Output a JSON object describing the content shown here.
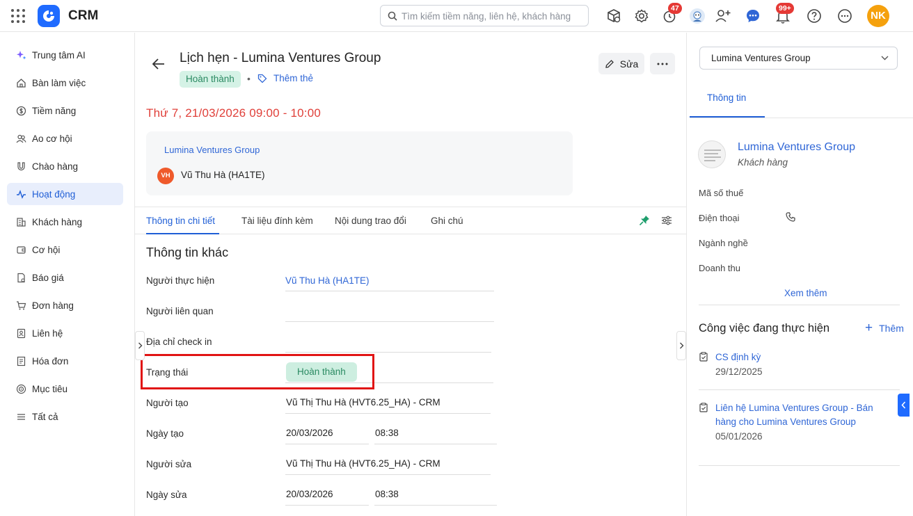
{
  "app": {
    "name": "CRM"
  },
  "search": {
    "placeholder": "Tìm kiếm tiềm năng, liên hệ, khách hàng"
  },
  "topbar": {
    "timer_badge": "47",
    "notifications_badge": "99+",
    "user_initials": "NK",
    "accent_color": "#1f6bff",
    "avatar_color": "#f5a10d",
    "badge_color": "#e53935"
  },
  "sidebar": {
    "items": [
      {
        "label": "Trung tâm AI",
        "icon": "sparkle-icon"
      },
      {
        "label": "Bàn làm việc",
        "icon": "home-icon"
      },
      {
        "label": "Tiềm năng",
        "icon": "dollar-circle-icon"
      },
      {
        "label": "Ao cơ hội",
        "icon": "users-icon"
      },
      {
        "label": "Chào hàng",
        "icon": "magnet-icon"
      },
      {
        "label": "Hoạt động",
        "icon": "activity-icon",
        "active": true
      },
      {
        "label": "Khách hàng",
        "icon": "building-icon"
      },
      {
        "label": "Cơ hội",
        "icon": "wallet-icon"
      },
      {
        "label": "Báo giá",
        "icon": "quote-document-icon"
      },
      {
        "label": "Đơn hàng",
        "icon": "cart-icon"
      },
      {
        "label": "Liên hệ",
        "icon": "contact-book-icon"
      },
      {
        "label": "Hóa đơn",
        "icon": "invoice-icon"
      },
      {
        "label": "Mục tiêu",
        "icon": "target-icon"
      },
      {
        "label": "Tất cả",
        "icon": "menu-lines-icon"
      }
    ]
  },
  "record": {
    "title": "Lịch hẹn - Lumina Ventures Group",
    "status": "Hoàn thành",
    "separator": "•",
    "add_tag": "Thêm thẻ",
    "edit_label": "Sửa",
    "datetime": "Thứ 7, 21/03/2026 09:00 - 10:00",
    "datetime_color": "#e0403a",
    "company": "Lumina Ventures Group",
    "person_initials": "VH",
    "person": "Vũ Thu Hà (HA1TE)"
  },
  "tabs": [
    "Thông tin chi tiết",
    "Tài liệu đính kèm",
    "Nội dung trao đổi",
    "Ghi chú"
  ],
  "details": {
    "section_title": "Thông tin khác",
    "assignee_label": "Người thực hiện",
    "assignee": "Vũ Thu Hà (HA1TE)",
    "related_label": "Người liên quan",
    "checkin_label": "Địa chỉ check in",
    "status_label": "Trạng thái",
    "status": "Hoàn thành",
    "creator_label": "Người tạo",
    "creator": "Vũ Thị Thu Hà (HVT6.25_HA) - CRM",
    "created_date_label": "Ngày tạo",
    "created_date": "20/03/2026",
    "created_time": "08:38",
    "editor_label": "Người sửa",
    "editor": "Vũ Thị Thu Hà (HVT6.25_HA) - CRM",
    "edited_date_label": "Ngày sửa",
    "edited_date": "20/03/2026",
    "edited_time": "08:38"
  },
  "right_panel": {
    "selected_company": "Lumina Ventures Group",
    "tab": "Thông tin",
    "company": "Lumina Ventures Group",
    "company_type": "Khách hàng",
    "tax_label": "Mã số thuế",
    "phone_label": "Điện thoại",
    "industry_label": "Ngành nghề",
    "revenue_label": "Doanh thu",
    "see_more": "Xem thêm",
    "work_title": "Công việc đang thực hiện",
    "add_label": "Thêm",
    "tasks": [
      {
        "title_line1": "CS định kỳ",
        "title_line2": "",
        "date": "29/12/2025"
      },
      {
        "title_line1": "Liên hệ Lumina Ventures Group - Bán",
        "title_line2": "hàng cho Lumina Ventures Group",
        "date": "05/01/2026"
      }
    ]
  }
}
